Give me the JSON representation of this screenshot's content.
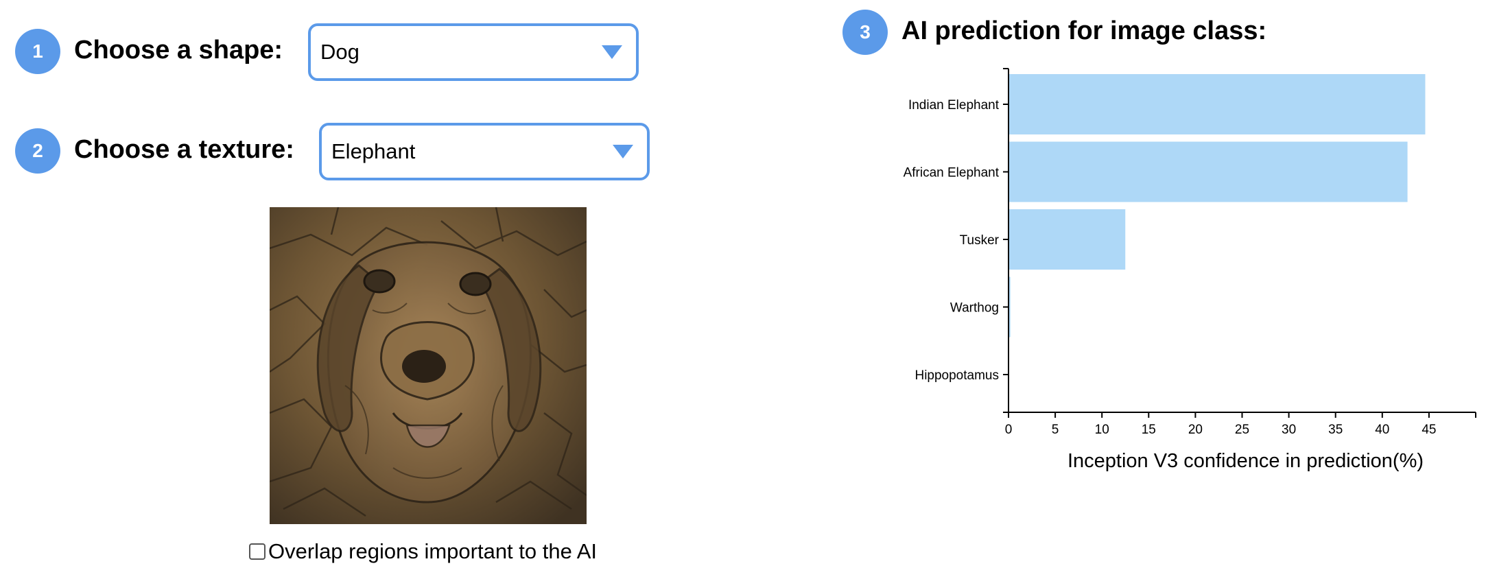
{
  "steps": {
    "shape": {
      "number": "1",
      "label": "Choose a shape:",
      "selected": "Dog",
      "options": [
        "Dog"
      ]
    },
    "texture": {
      "number": "2",
      "label": "Choose a texture:",
      "selected": "Elephant",
      "options": [
        "Elephant"
      ]
    },
    "prediction": {
      "number": "3",
      "label": "AI prediction for image class:"
    }
  },
  "image": {
    "description_icon": "dog-with-elephant-texture-image"
  },
  "overlap": {
    "label": "Overlap regions important to the AI",
    "checked": false
  },
  "colors": {
    "accent": "#5b9ae9",
    "bar": "#aed8f7"
  },
  "chart_data": {
    "type": "bar",
    "orientation": "horizontal",
    "categories": [
      "Indian Elephant",
      "African Elephant",
      "Tusker",
      "Warthog",
      "Hippopotamus"
    ],
    "values": [
      44.6,
      42.7,
      12.5,
      0.2,
      0.0
    ],
    "xlabel": "Inception V3 confidence in prediction(%)",
    "ylabel": "",
    "xlim": [
      0,
      50
    ],
    "xticks": [
      0,
      5,
      10,
      15,
      20,
      25,
      30,
      35,
      40,
      45
    ],
    "grid": false
  }
}
